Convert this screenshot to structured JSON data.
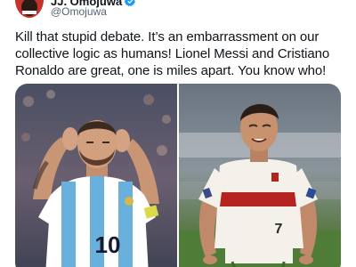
{
  "author": {
    "name": "JJ. Omojuwa",
    "handle": "@Omojuwa",
    "verified": true,
    "avatar_color": "#c5332b"
  },
  "tweet": {
    "text": "Kill that stupid debate. It’s an embarrassment on our collective logic as humans! Lionel Messi and Cristiano Ronaldo are great, one is miles apart. You know who!"
  },
  "media": {
    "left_photo": {
      "jersey_number": "10"
    },
    "right_photo": {
      "jersey_number": "7"
    }
  },
  "colors": {
    "verified_blue": "#1d9bf0",
    "handle_gray": "#536471",
    "argentina_sky_blue": "#6ab0dd",
    "portugal_red": "#b5231f"
  }
}
